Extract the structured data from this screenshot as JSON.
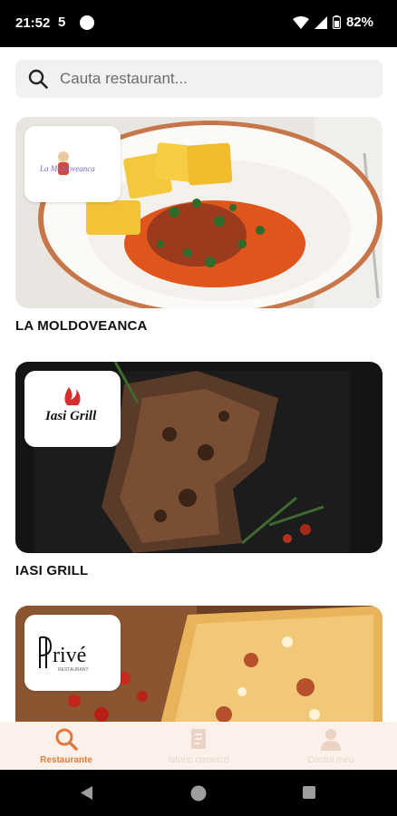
{
  "status": {
    "time": "21:52",
    "s_icon": "5",
    "battery": "82%"
  },
  "search": {
    "placeholder": "Cauta restaurant..."
  },
  "restaurants": [
    {
      "name": "LA MOLDOVEANCA",
      "logo_text": "La Moldoveanca"
    },
    {
      "name": "IASI GRILL",
      "logo_text": "Iasi Grill"
    },
    {
      "name": "",
      "logo_text": "Prive"
    }
  ],
  "nav": {
    "items": [
      {
        "label": "Restaurante",
        "icon": "search-icon",
        "active": true
      },
      {
        "label": "Istoric comenzi",
        "icon": "receipt-icon",
        "active": false
      },
      {
        "label": "Contul meu",
        "icon": "user-icon",
        "active": false
      }
    ]
  },
  "colors": {
    "accent": "#e07a3c",
    "nav_bg": "#fbf1ea",
    "search_bg": "#f1f1f1"
  }
}
